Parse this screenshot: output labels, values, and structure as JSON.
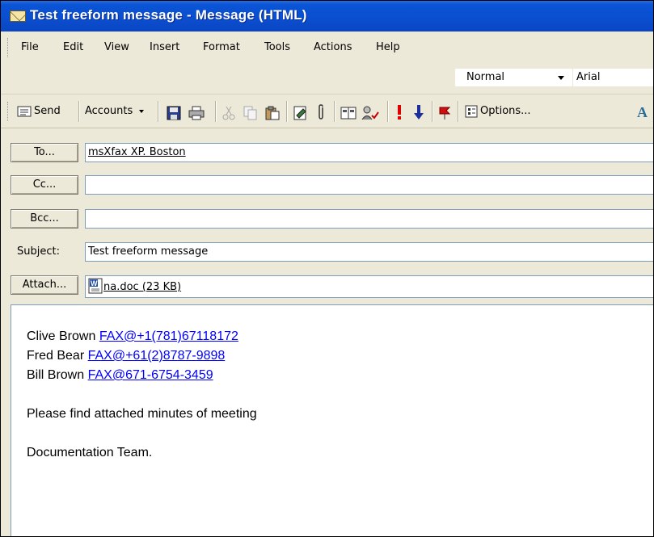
{
  "window": {
    "title": "Test freeform message - Message (HTML)"
  },
  "menu": [
    "File",
    "Edit",
    "View",
    "Insert",
    "Format",
    "Tools",
    "Actions",
    "Help"
  ],
  "format_toolbar": {
    "style_value": "Normal",
    "font_value": "Arial"
  },
  "toolbar": {
    "send_label": "Send",
    "accounts_label": "Accounts",
    "options_label": "Options...",
    "icons": [
      "send-icon",
      "save-icon",
      "print-icon",
      "cut-icon",
      "copy-icon",
      "paste-icon",
      "signature-icon",
      "attach-icon",
      "address-book-icon",
      "check-names-icon",
      "importance-high-icon",
      "importance-low-icon",
      "follow-up-flag-icon",
      "options-icon",
      "format-icon"
    ]
  },
  "header": {
    "to_button": "To...",
    "to_value": "msXfax XP. Boston",
    "cc_button": "Cc...",
    "cc_value": "",
    "bcc_button": "Bcc...",
    "bcc_value": "",
    "subject_label": "Subject:",
    "subject_value": "Test freeform message",
    "attach_button": "Attach...",
    "attachment": "na.doc (23 KB)"
  },
  "body": {
    "recipients": [
      {
        "name": "Clive Brown",
        "fax": "FAX@+1(781)67118172"
      },
      {
        "name": "Fred Bear",
        "fax": "FAX@+61(2)8787-9898"
      },
      {
        "name": "Bill Brown",
        "fax": "FAX@671-6754-3459"
      }
    ],
    "message": "Please find attached minutes of meeting",
    "signature": "Documentation Team."
  },
  "colors": {
    "titlebar": "#0a54d6",
    "link": "#0000ff",
    "chrome": "#ece9d8"
  }
}
